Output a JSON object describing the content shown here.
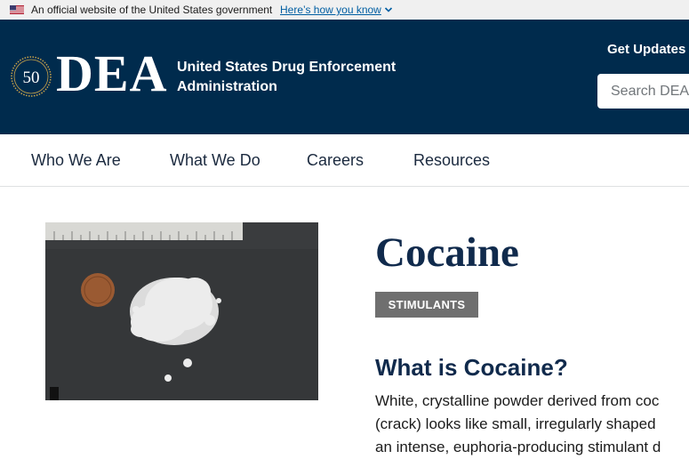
{
  "gov_banner": {
    "text": "An official website of the United States government",
    "link": "Here’s how you know"
  },
  "header": {
    "wordmark": "DEA",
    "agency_name_line1": "United States Drug Enforcement",
    "agency_name_line2": "Administration",
    "get_updates": "Get Updates",
    "search_placeholder": "Search DEA",
    "seal_text": "50"
  },
  "nav": {
    "items": [
      {
        "label": "Who We Are"
      },
      {
        "label": "What We Do"
      },
      {
        "label": "Careers"
      },
      {
        "label": "Resources"
      }
    ]
  },
  "main": {
    "title": "Cocaine",
    "category": "STIMULANTS",
    "section_heading": "What is Cocaine?",
    "body_lines": [
      "White, crystalline powder derived from coc",
      "(crack) looks like small, irregularly shaped",
      "an intense, euphoria-producing stimulant d"
    ]
  },
  "colors": {
    "header_bg": "#002b4d",
    "title_text": "#102a4c",
    "badge_bg": "#6f6f6f",
    "link": "#005ea2"
  },
  "icons": [
    "us-flag-icon",
    "chevron-down-icon",
    "dea-50-seal-icon"
  ]
}
